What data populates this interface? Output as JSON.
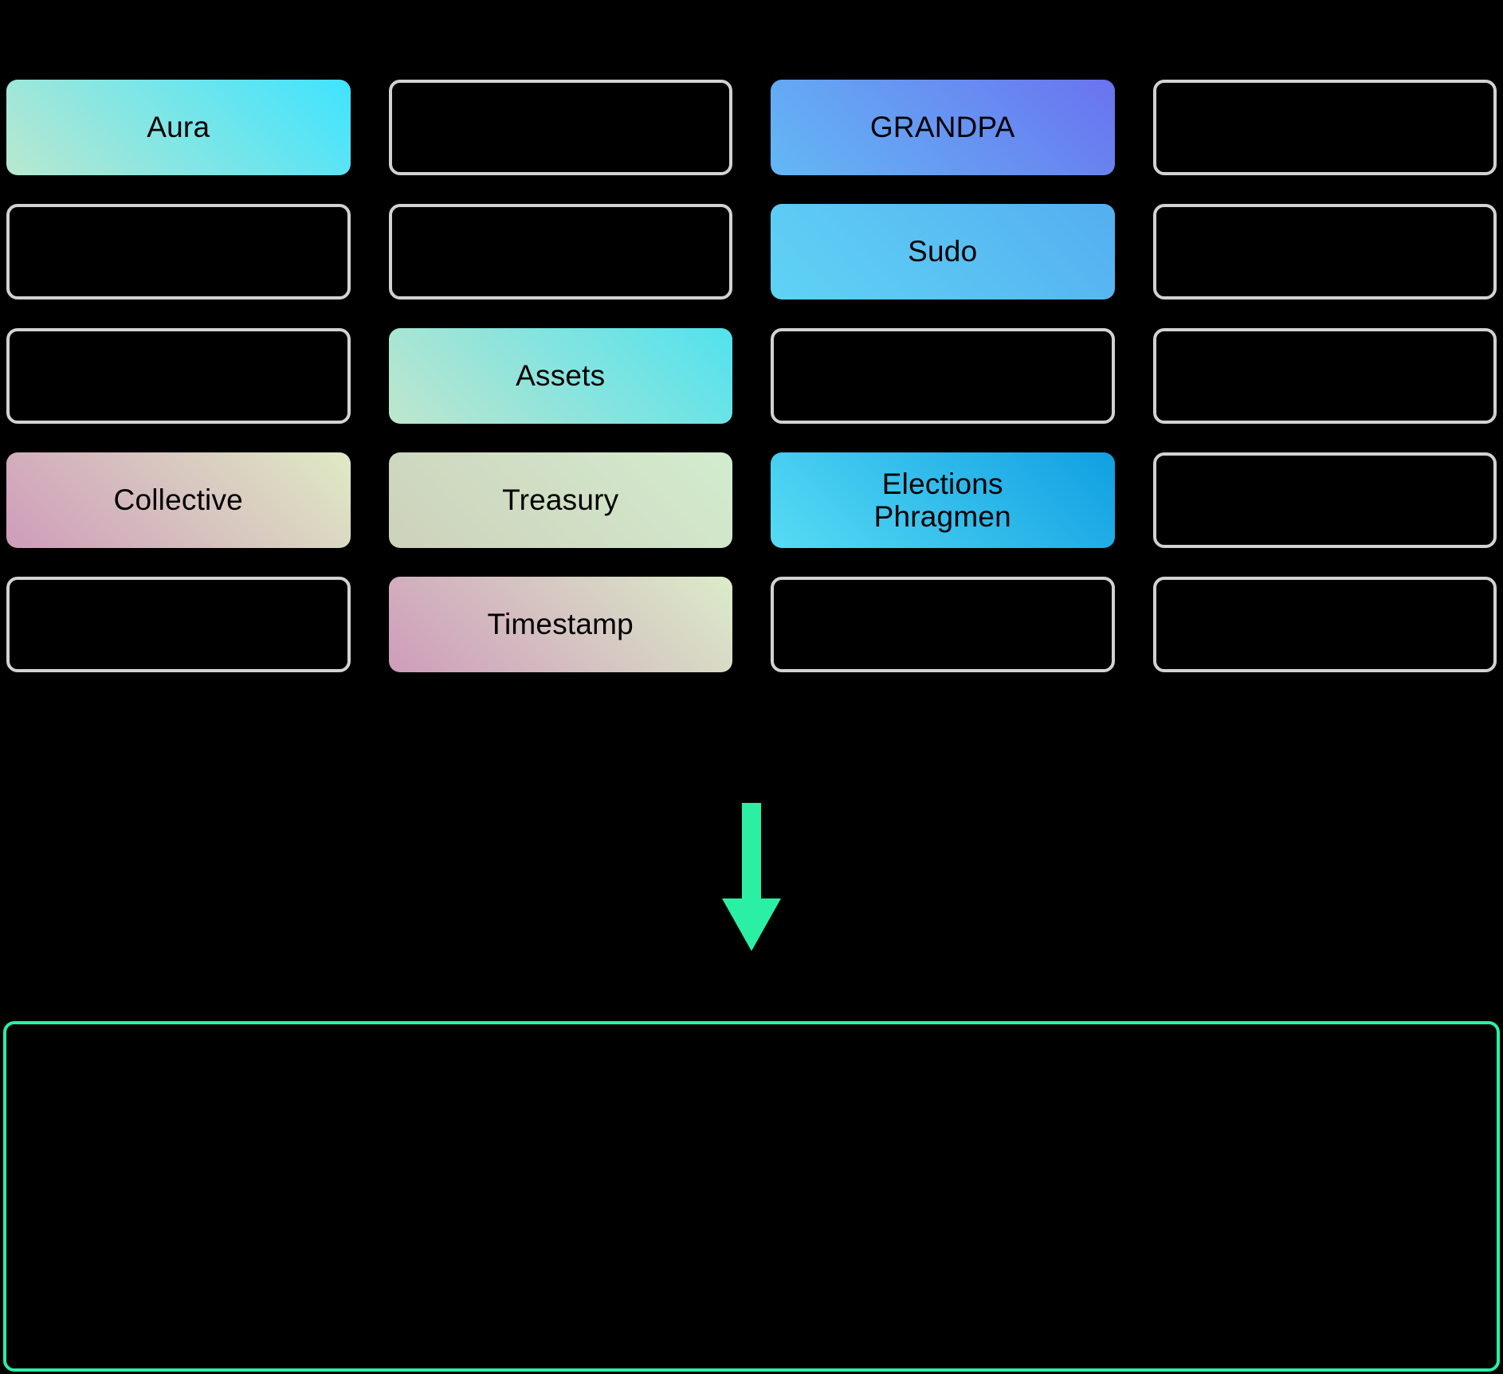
{
  "diagram": {
    "type": "runtime-pallet-composition",
    "background_color": "#000000",
    "accent_color": "#2bf0a4",
    "empty_border_color": "#d2d2d2",
    "arrow": {
      "icon": "arrow-down-icon",
      "direction": "down",
      "color": "#2bf0a4"
    },
    "runtime_box": {
      "label": "",
      "border_color": "#2bf0a4"
    }
  },
  "grid": {
    "columns": 4,
    "rows": 5,
    "cells": [
      {
        "id": "r1c1",
        "label": "Aura",
        "filled": true,
        "gradient_from": "#b9e8cf",
        "gradient_to": "#3fe3ff"
      },
      {
        "id": "r1c2",
        "label": "",
        "filled": false,
        "gradient_from": "",
        "gradient_to": ""
      },
      {
        "id": "r1c3",
        "label": "GRANDPA",
        "filled": true,
        "gradient_from": "#63b8f5",
        "gradient_to": "#6a73ef"
      },
      {
        "id": "r1c4",
        "label": "",
        "filled": false,
        "gradient_from": "",
        "gradient_to": ""
      },
      {
        "id": "r2c1",
        "label": "",
        "filled": false,
        "gradient_from": "",
        "gradient_to": ""
      },
      {
        "id": "r2c2",
        "label": "",
        "filled": false,
        "gradient_from": "",
        "gradient_to": ""
      },
      {
        "id": "r2c3",
        "label": "Sudo",
        "filled": true,
        "gradient_from": "#5fd3f5",
        "gradient_to": "#55aef0"
      },
      {
        "id": "r2c4",
        "label": "",
        "filled": false,
        "gradient_from": "",
        "gradient_to": ""
      },
      {
        "id": "r3c1",
        "label": "",
        "filled": false,
        "gradient_from": "",
        "gradient_to": ""
      },
      {
        "id": "r3c2",
        "label": "Assets",
        "filled": true,
        "gradient_from": "#bfe6cd",
        "gradient_to": "#52e2ee"
      },
      {
        "id": "r3c3",
        "label": "",
        "filled": false,
        "gradient_from": "",
        "gradient_to": ""
      },
      {
        "id": "r3c4",
        "label": "",
        "filled": false,
        "gradient_from": "",
        "gradient_to": ""
      },
      {
        "id": "r4c1",
        "label": "Collective",
        "filled": true,
        "gradient_from": "#cf9cba",
        "gradient_to": "#dfeac4"
      },
      {
        "id": "r4c2",
        "label": "Treasury",
        "filled": true,
        "gradient_from": "#cdd2bb",
        "gradient_to": "#d3ecce"
      },
      {
        "id": "r4c3",
        "label": "Elections\nPhragmen",
        "filled": true,
        "gradient_from": "#57dbf4",
        "gradient_to": "#109fe2"
      },
      {
        "id": "r4c4",
        "label": "",
        "filled": false,
        "gradient_from": "",
        "gradient_to": ""
      },
      {
        "id": "r5c1",
        "label": "",
        "filled": false,
        "gradient_from": "",
        "gradient_to": ""
      },
      {
        "id": "r5c2",
        "label": "Timestamp",
        "filled": true,
        "gradient_from": "#cf9cba",
        "gradient_to": "#dbecc9"
      },
      {
        "id": "r5c3",
        "label": "",
        "filled": false,
        "gradient_from": "",
        "gradient_to": ""
      },
      {
        "id": "r5c4",
        "label": "",
        "filled": false,
        "gradient_from": "",
        "gradient_to": ""
      }
    ]
  }
}
